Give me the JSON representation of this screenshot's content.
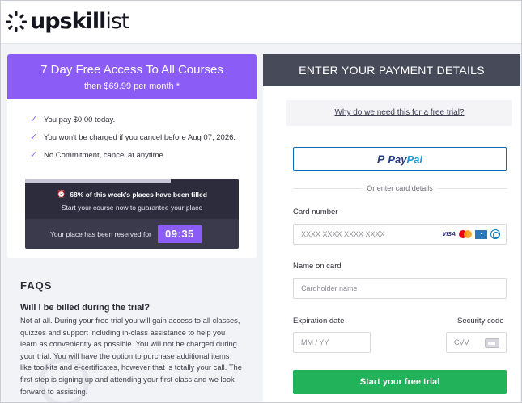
{
  "brand": {
    "name_bold": "upskill",
    "name_rest": "ist"
  },
  "offer": {
    "title": "7 Day Free Access To All Courses",
    "subtitle": "then  $69.99 per month",
    "subtitle_mark": "*",
    "benefits": [
      "You pay $0.00 today.",
      "You won't be charged if you cancel before Aug 07, 2026.",
      "No Commitment, cancel at anytime."
    ],
    "places": {
      "filled_text": "68% of this week's places have been filled",
      "filled_fraction": 0.68,
      "guarantee_text": "Start your course now to guarantee your place",
      "reserved_text": "Your place has been reserved for",
      "timer": "09:35"
    }
  },
  "faq": {
    "title": "FAQS",
    "question": "Will I be billed during the trial?",
    "answer": "Not at all. During your free trial you will gain access to all classes, quizzes and support including in-class assistance to help you learn as conveniently as possible. You will not be charged during your trial. You will have the option to purchase additional items like toolkits and e-certificates, however that is totally your call. The first step is signing up and attending your first class and we look forward to assisting."
  },
  "payment": {
    "header": "ENTER YOUR PAYMENT DETAILS",
    "why_link": "Why do we need this for a free trial?",
    "paypal_part1": "Pay",
    "paypal_part2": "Pal",
    "or_text": "Or enter card details",
    "card_number_label": "Card number",
    "card_number_placeholder": "XXXX XXXX XXXX XXXX",
    "card_brands": [
      "VISA",
      "Mastercard",
      "American Express",
      "Diners Club"
    ],
    "name_label": "Name on card",
    "name_placeholder": "Cardholder name",
    "expiry_label": "Expiration date",
    "expiry_placeholder": "MM / YY",
    "security_label": "Security code",
    "cvv_placeholder": "CVV",
    "submit_label": "Start your free trial"
  },
  "colors": {
    "accent": "#8b5cf6",
    "header_dark": "#474a58",
    "submit_green": "#22b25a",
    "paypal_blue": "#253b80"
  }
}
